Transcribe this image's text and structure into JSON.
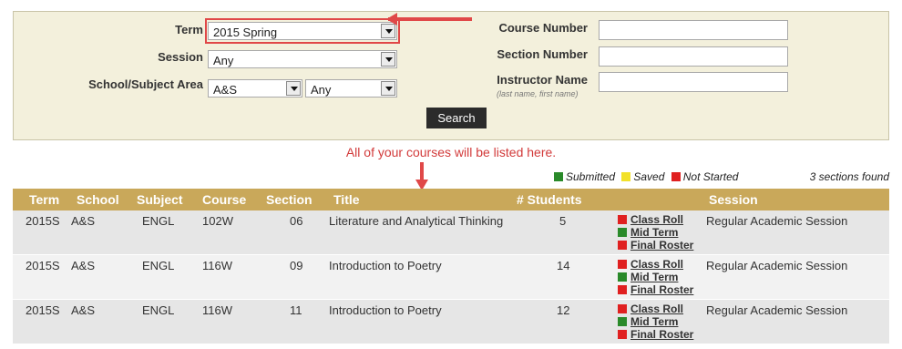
{
  "search": {
    "term_label": "Term",
    "term_value": "2015 Spring",
    "session_label": "Session",
    "session_value": "Any",
    "school_label": "School/Subject Area",
    "school_value": "A&S",
    "subject_value": "Any",
    "course_number_label": "Course Number",
    "section_number_label": "Section Number",
    "instructor_label": "Instructor Name",
    "instructor_hint": "(last name, first name)",
    "course_number_value": "",
    "section_number_value": "",
    "instructor_value": "",
    "search_button": "Search"
  },
  "annotation": {
    "note": "All of your courses will be listed here."
  },
  "legend": {
    "submitted": "Submitted",
    "saved": "Saved",
    "not_started": "Not Started",
    "colors": {
      "submitted": "#2a8a2a",
      "saved": "#f2e12a",
      "not_started": "#e02020"
    },
    "count": "3 sections found"
  },
  "table": {
    "headers": {
      "term": "Term",
      "school": "School",
      "subject": "Subject",
      "course": "Course",
      "section": "Section",
      "title": "Title",
      "students": "# Students",
      "session": "Session"
    },
    "link_labels": {
      "class_roll": "Class Roll",
      "mid_term": "Mid Term",
      "final_roster": "Final Roster"
    },
    "rows": [
      {
        "term": "2015S",
        "school": "A&S",
        "subject": "ENGL",
        "course": "102W",
        "section": "06",
        "title": "Literature and Analytical Thinking",
        "students": "5",
        "session": "Regular Academic Session",
        "status": {
          "class_roll": "red",
          "mid_term": "green",
          "final_roster": "red"
        }
      },
      {
        "term": "2015S",
        "school": "A&S",
        "subject": "ENGL",
        "course": "116W",
        "section": "09",
        "title": "Introduction to Poetry",
        "students": "14",
        "session": "Regular Academic Session",
        "status": {
          "class_roll": "red",
          "mid_term": "green",
          "final_roster": "red"
        }
      },
      {
        "term": "2015S",
        "school": "A&S",
        "subject": "ENGL",
        "course": "116W",
        "section": "11",
        "title": "Introduction to Poetry",
        "students": "12",
        "session": "Regular Academic Session",
        "status": {
          "class_roll": "red",
          "mid_term": "green",
          "final_roster": "red"
        }
      }
    ]
  }
}
